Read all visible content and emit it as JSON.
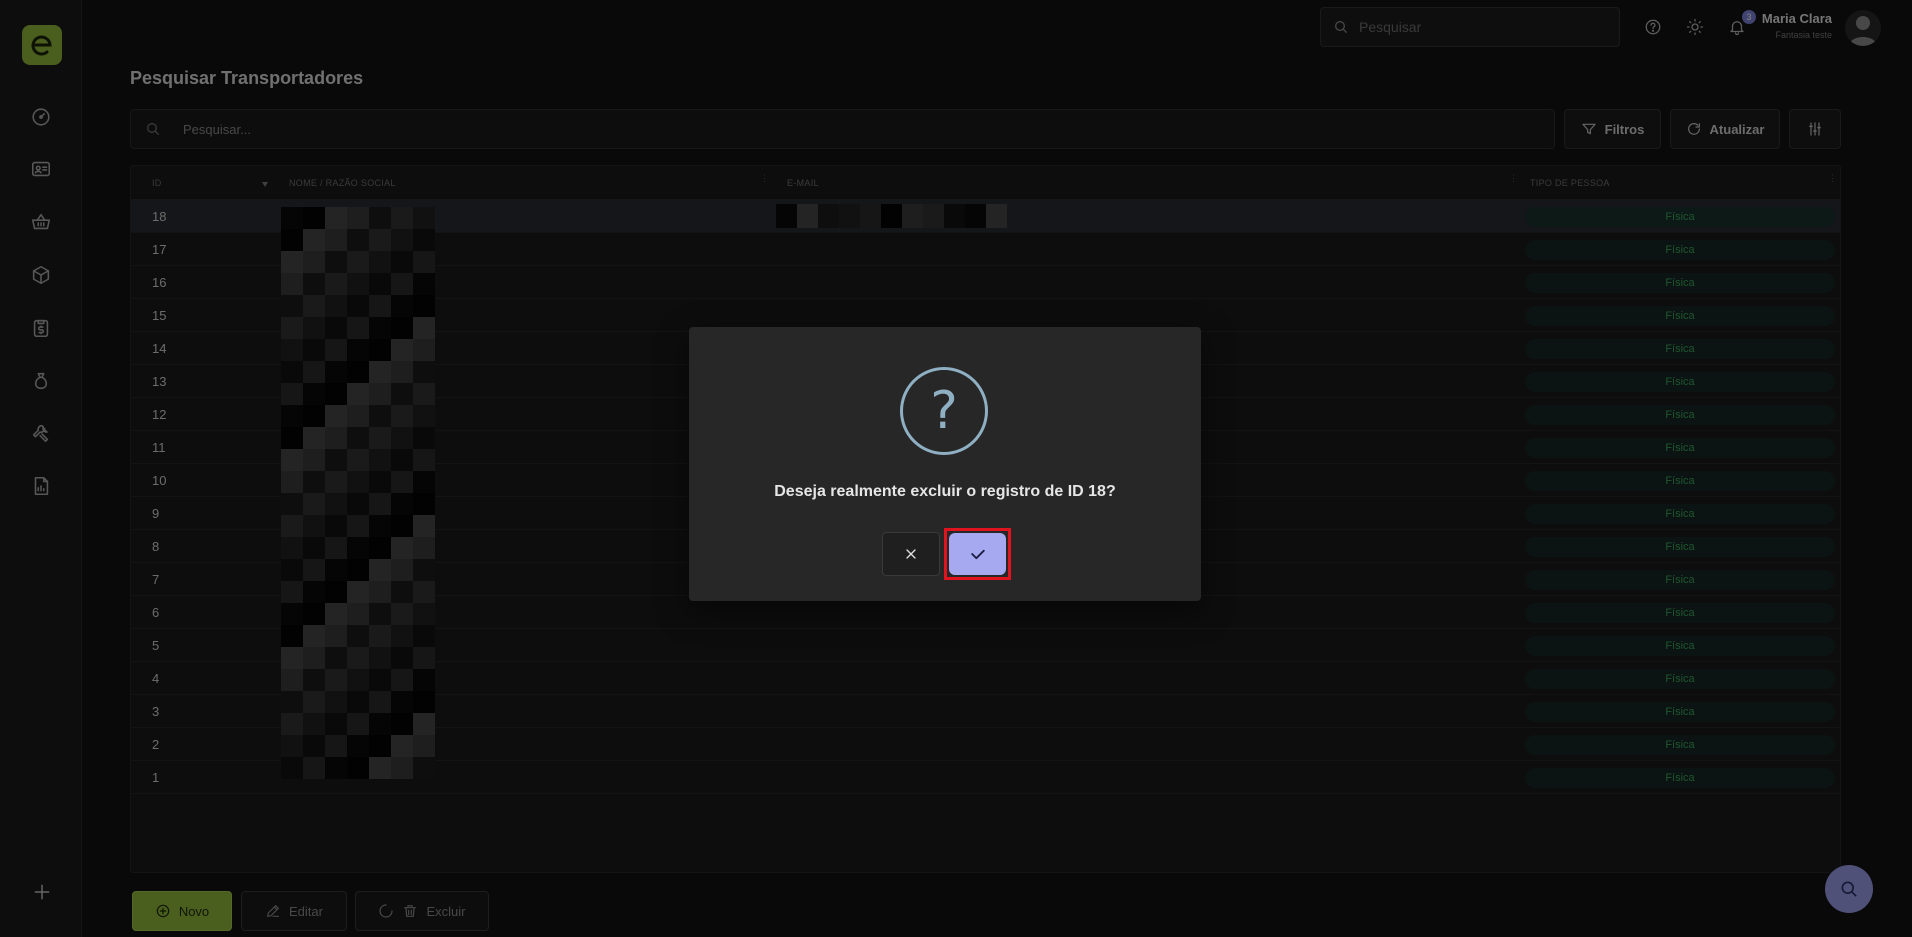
{
  "header": {
    "search_placeholder": "Pesquisar",
    "user_name": "Maria Clara",
    "user_company": "Fantasia teste",
    "notification_count": "3"
  },
  "page": {
    "title": "Pesquisar Transportadores"
  },
  "toolbar": {
    "search_placeholder": "Pesquisar...",
    "filters_label": "Filtros",
    "refresh_label": "Atualizar"
  },
  "table": {
    "columns": [
      "ID",
      "NOME / RAZÃO SOCIAL",
      "E-MAIL",
      "TIPO DE PESSOA"
    ],
    "rows": [
      {
        "id": "18",
        "tipo": "Física"
      },
      {
        "id": "17",
        "tipo": "Física"
      },
      {
        "id": "16",
        "tipo": "Física"
      },
      {
        "id": "15",
        "tipo": "Física"
      },
      {
        "id": "14",
        "tipo": "Física"
      },
      {
        "id": "13",
        "tipo": "Física"
      },
      {
        "id": "12",
        "tipo": "Física"
      },
      {
        "id": "11",
        "tipo": "Física"
      },
      {
        "id": "10",
        "tipo": "Física"
      },
      {
        "id": "9",
        "tipo": "Física"
      },
      {
        "id": "8",
        "tipo": "Física"
      },
      {
        "id": "7",
        "tipo": "Física"
      },
      {
        "id": "6",
        "tipo": "Física"
      },
      {
        "id": "5",
        "tipo": "Física"
      },
      {
        "id": "4",
        "tipo": "Física"
      },
      {
        "id": "3",
        "tipo": "Física"
      },
      {
        "id": "2",
        "tipo": "Física"
      },
      {
        "id": "1",
        "tipo": "Física"
      }
    ]
  },
  "footer": {
    "new_label": "Novo",
    "edit_label": "Editar",
    "delete_label": "Excluir"
  },
  "dialog": {
    "icon": "?",
    "message": "Deseja realmente excluir o registro de ID 18?"
  },
  "colors": {
    "brand": "#8fb43a",
    "accent": "#a6a9f0",
    "pill_text": "#3aa35a",
    "highlight": "#e0141e"
  }
}
